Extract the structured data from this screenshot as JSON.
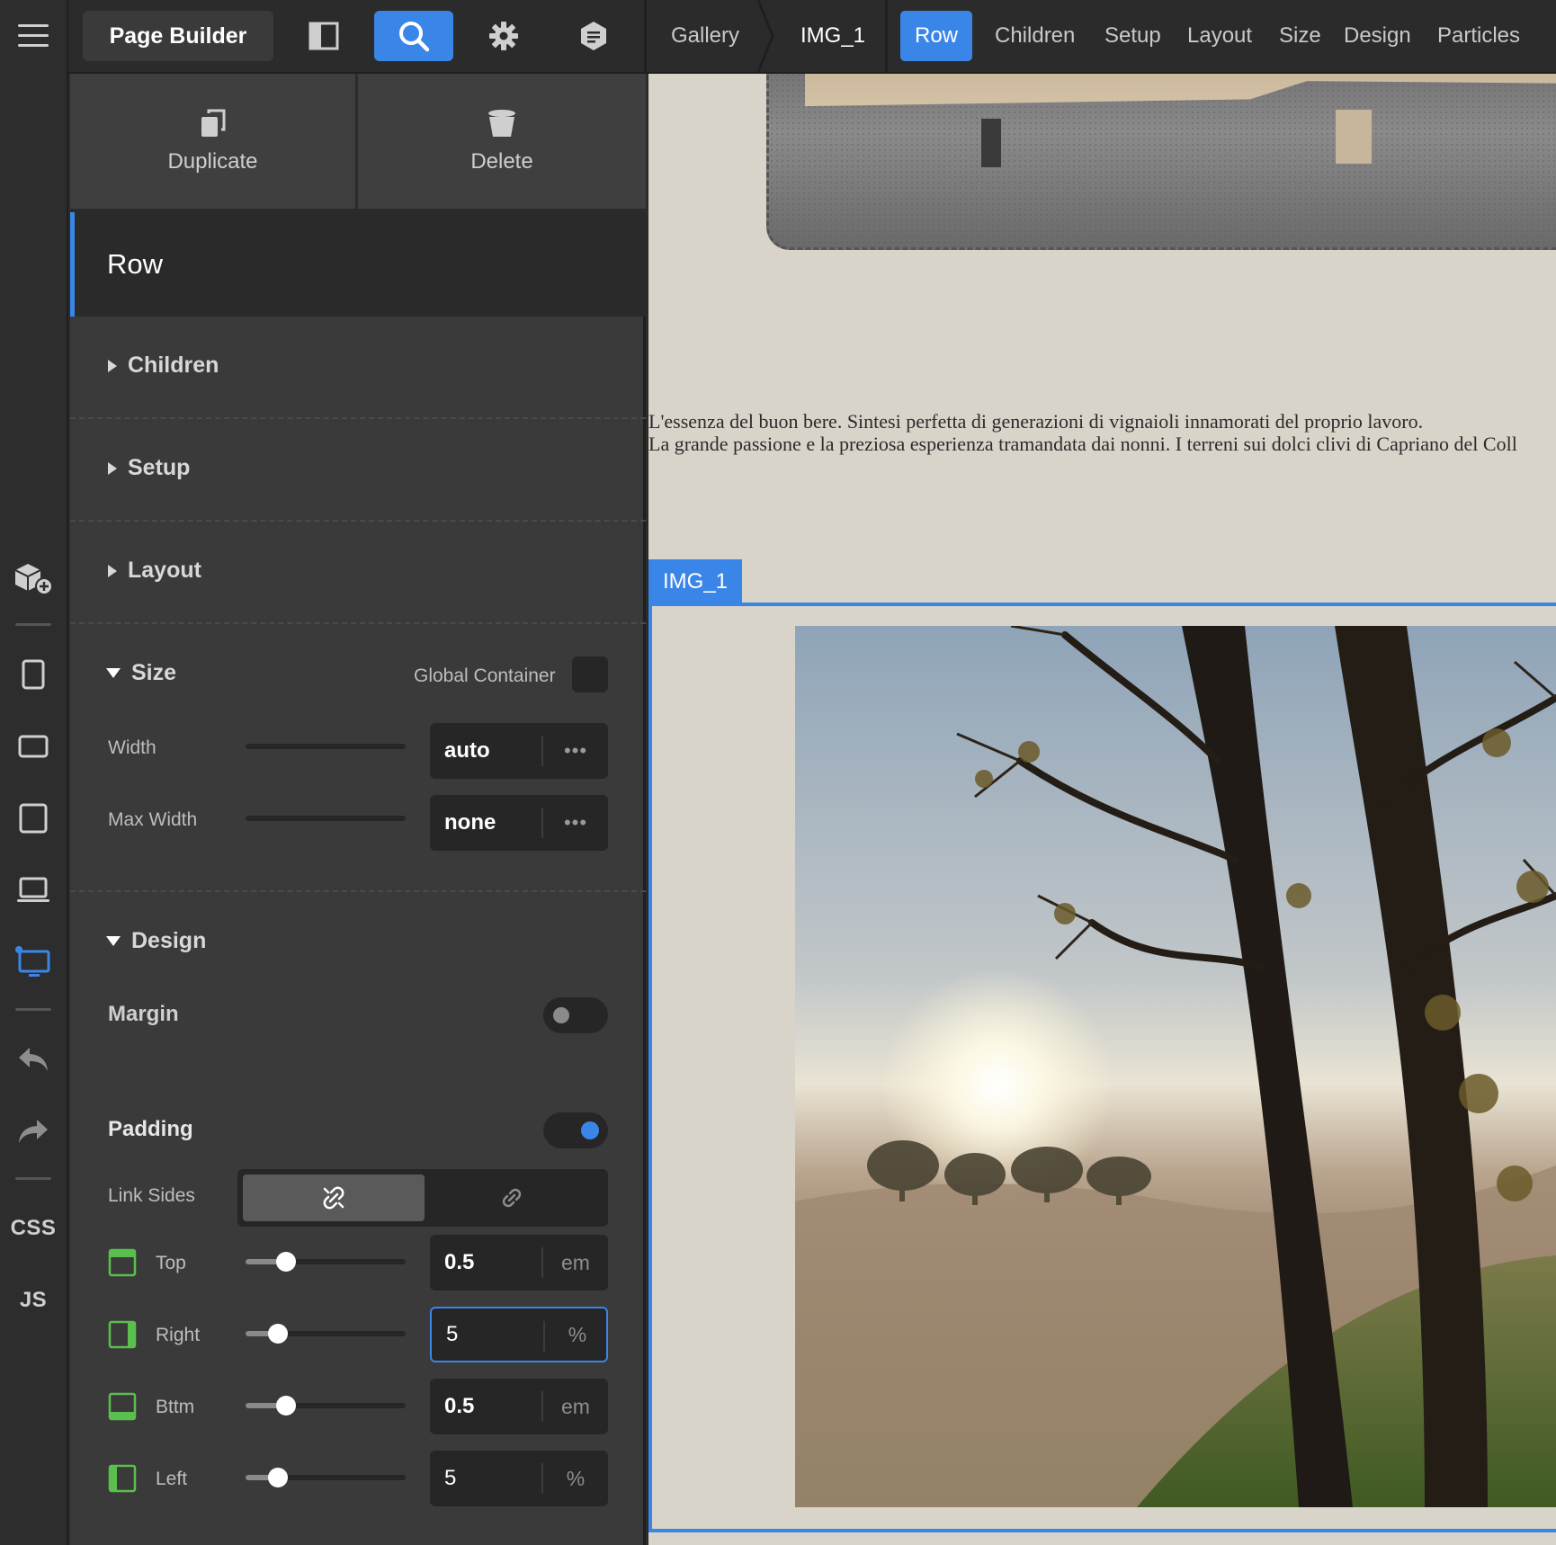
{
  "app": {
    "brand": "Page Builder",
    "colors": {
      "accent": "#3a86e8",
      "panel": "#3a3a3a",
      "canvas": "#d9d4ca"
    }
  },
  "toolbar": {
    "icons": [
      "sidebar-layout-icon",
      "search-icon",
      "gear-icon",
      "hexagon-message-icon"
    ],
    "breadcrumb": [
      "Gallery",
      "IMG_1"
    ],
    "tabs": [
      "Row",
      "Children",
      "Setup",
      "Layout",
      "Size",
      "Design",
      "Particles"
    ],
    "active_tab": "Row"
  },
  "rail": {
    "icons": [
      "add-block-icon",
      "phone-icon",
      "landscape-phone-icon",
      "tablet-icon",
      "laptop-icon",
      "desktop-icon",
      "undo-icon",
      "redo-icon"
    ],
    "css_label": "CSS",
    "js_label": "JS"
  },
  "panel": {
    "actions": {
      "duplicate": "Duplicate",
      "delete": "Delete"
    },
    "element_title": "Row",
    "sections": {
      "children": "Children",
      "setup": "Setup",
      "layout": "Layout"
    },
    "size": {
      "title": "Size",
      "global_container": "Global Container",
      "width_label": "Width",
      "width_value": "auto",
      "max_width_label": "Max Width",
      "max_width_value": "none",
      "more": "•••"
    },
    "design": {
      "title": "Design",
      "margin_label": "Margin",
      "margin_enabled": false,
      "padding_label": "Padding",
      "padding_enabled": true,
      "link_sides_label": "Link Sides",
      "padding": {
        "top": {
          "label": "Top",
          "value": "0.5",
          "unit": "em",
          "slider": 0.25
        },
        "right": {
          "label": "Right",
          "value": "5",
          "unit": "%",
          "slider": 0.2
        },
        "bottom": {
          "label": "Bttm",
          "value": "0.5",
          "unit": "em",
          "slider": 0.25
        },
        "left": {
          "label": "Left",
          "value": "5",
          "unit": "%",
          "slider": 0.2
        }
      }
    }
  },
  "canvas": {
    "paragraph_1": "L'essenza del buon bere. Sintesi perfetta di generazioni di vignaioli innamorati del proprio lavoro.",
    "paragraph_2": "La grande passione e la preziosa esperienza tramandata dai nonni. I terreni sui dolci clivi di Capriano del Coll",
    "image_tag": "IMG_1"
  }
}
